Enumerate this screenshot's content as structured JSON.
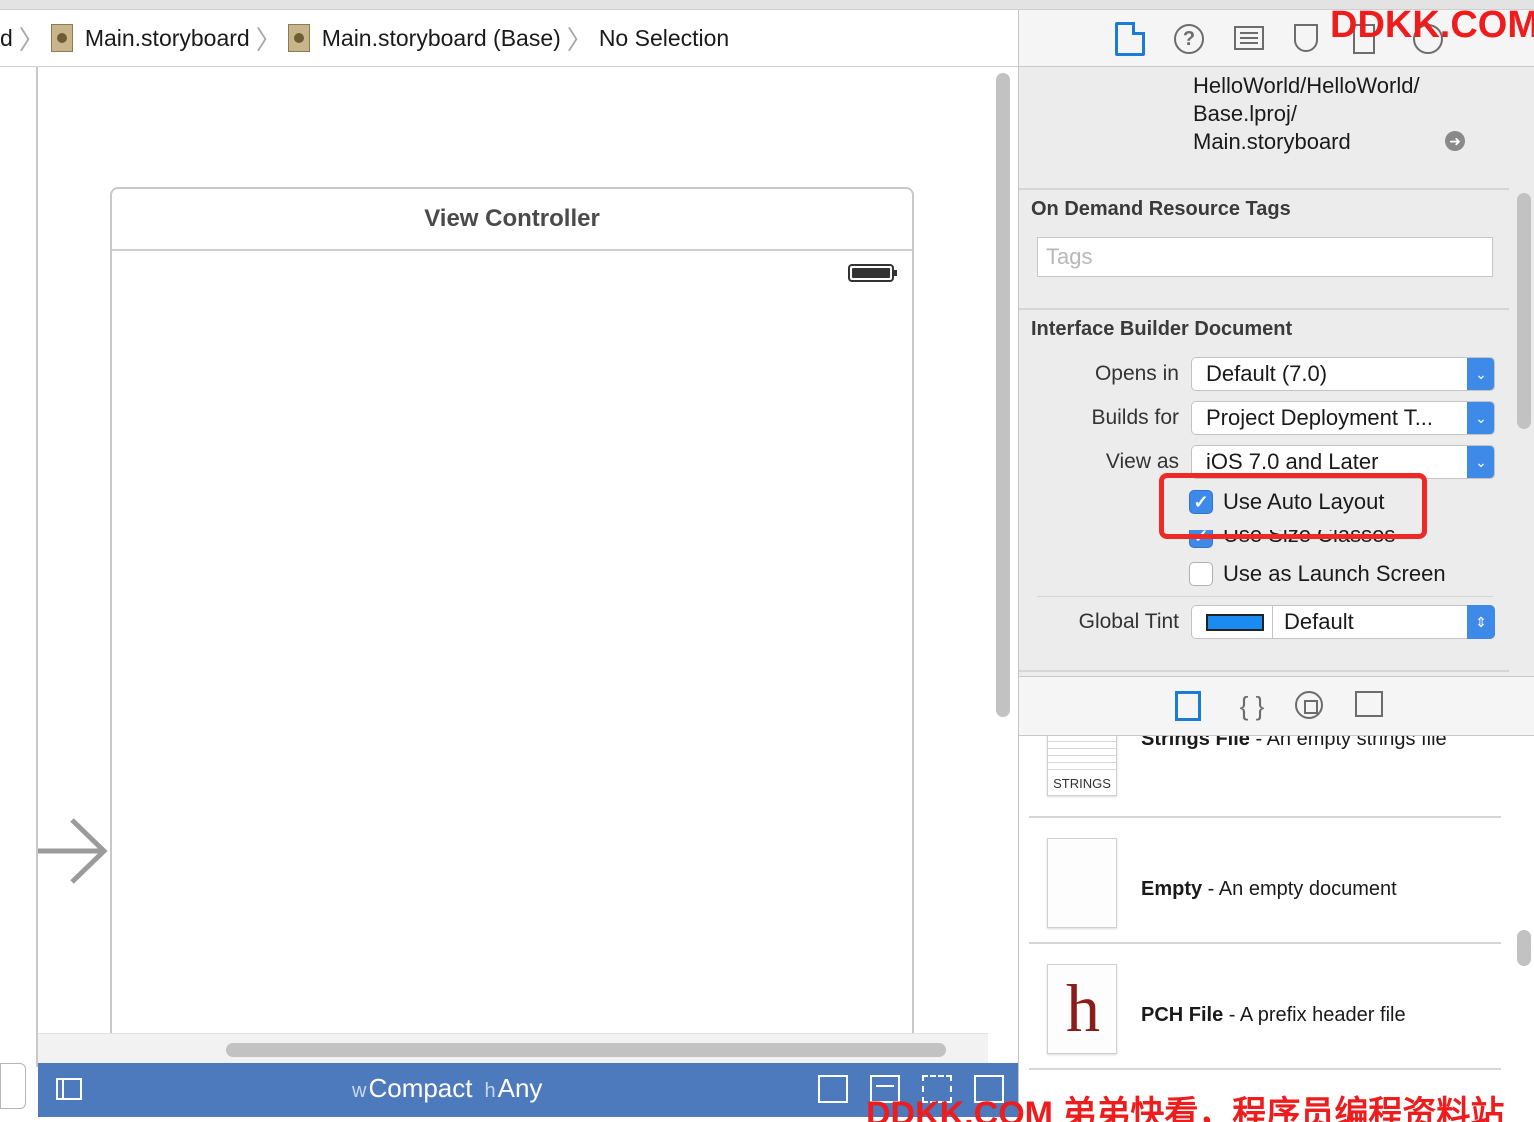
{
  "breadcrumb": {
    "partial": "d",
    "items": [
      "Main.storyboard",
      "Main.storyboard (Base)",
      "No Selection"
    ]
  },
  "canvas": {
    "scene_title": "View Controller"
  },
  "size_class": {
    "w_prefix": "w",
    "w_value": "Compact",
    "h_prefix": "h",
    "h_value": "Any"
  },
  "inspector": {
    "tabs": [
      "file-icon",
      "help-icon",
      "identity-icon",
      "attributes-icon",
      "size-icon",
      "connections-icon"
    ],
    "file_path_lines": [
      "HelloWorld/HelloWorld/",
      "Base.lproj/",
      "Main.storyboard"
    ],
    "on_demand": {
      "title": "On Demand Resource Tags",
      "tags_placeholder": "Tags"
    },
    "ib_document": {
      "title": "Interface Builder Document",
      "opens_in_label": "Opens in",
      "opens_in_value": "Default (7.0)",
      "builds_for_label": "Builds for",
      "builds_for_value": "Project Deployment T...",
      "view_as_label": "View as",
      "view_as_value": "iOS 7.0 and Later",
      "use_auto_layout": "Use Auto Layout",
      "use_size_classes": "Use Size Classes",
      "use_launch_screen": "Use as Launch Screen",
      "global_tint_label": "Global Tint",
      "global_tint_value": "Default",
      "tint_color": "#1a8bf0"
    }
  },
  "library": {
    "tabs": [
      "file-template-icon",
      "code-snippet-icon",
      "object-icon",
      "media-icon"
    ],
    "items": [
      {
        "name": "Strings File",
        "desc": " - An empty strings file",
        "thumb_tag": "STRINGS"
      },
      {
        "name": "Empty",
        "desc": " - An empty document",
        "thumb_tag": ""
      },
      {
        "name": "PCH File",
        "desc": " - A prefix header file",
        "thumb_tag": "h"
      }
    ]
  },
  "watermark": {
    "top": "DDKK.COM",
    "bottom": "DDKK.COM 弟弟快看，程序员编程资料站"
  },
  "colors": {
    "accent": "#3d8ae8",
    "highlight": "#ee2a26",
    "size_bar": "#4d79bd"
  }
}
